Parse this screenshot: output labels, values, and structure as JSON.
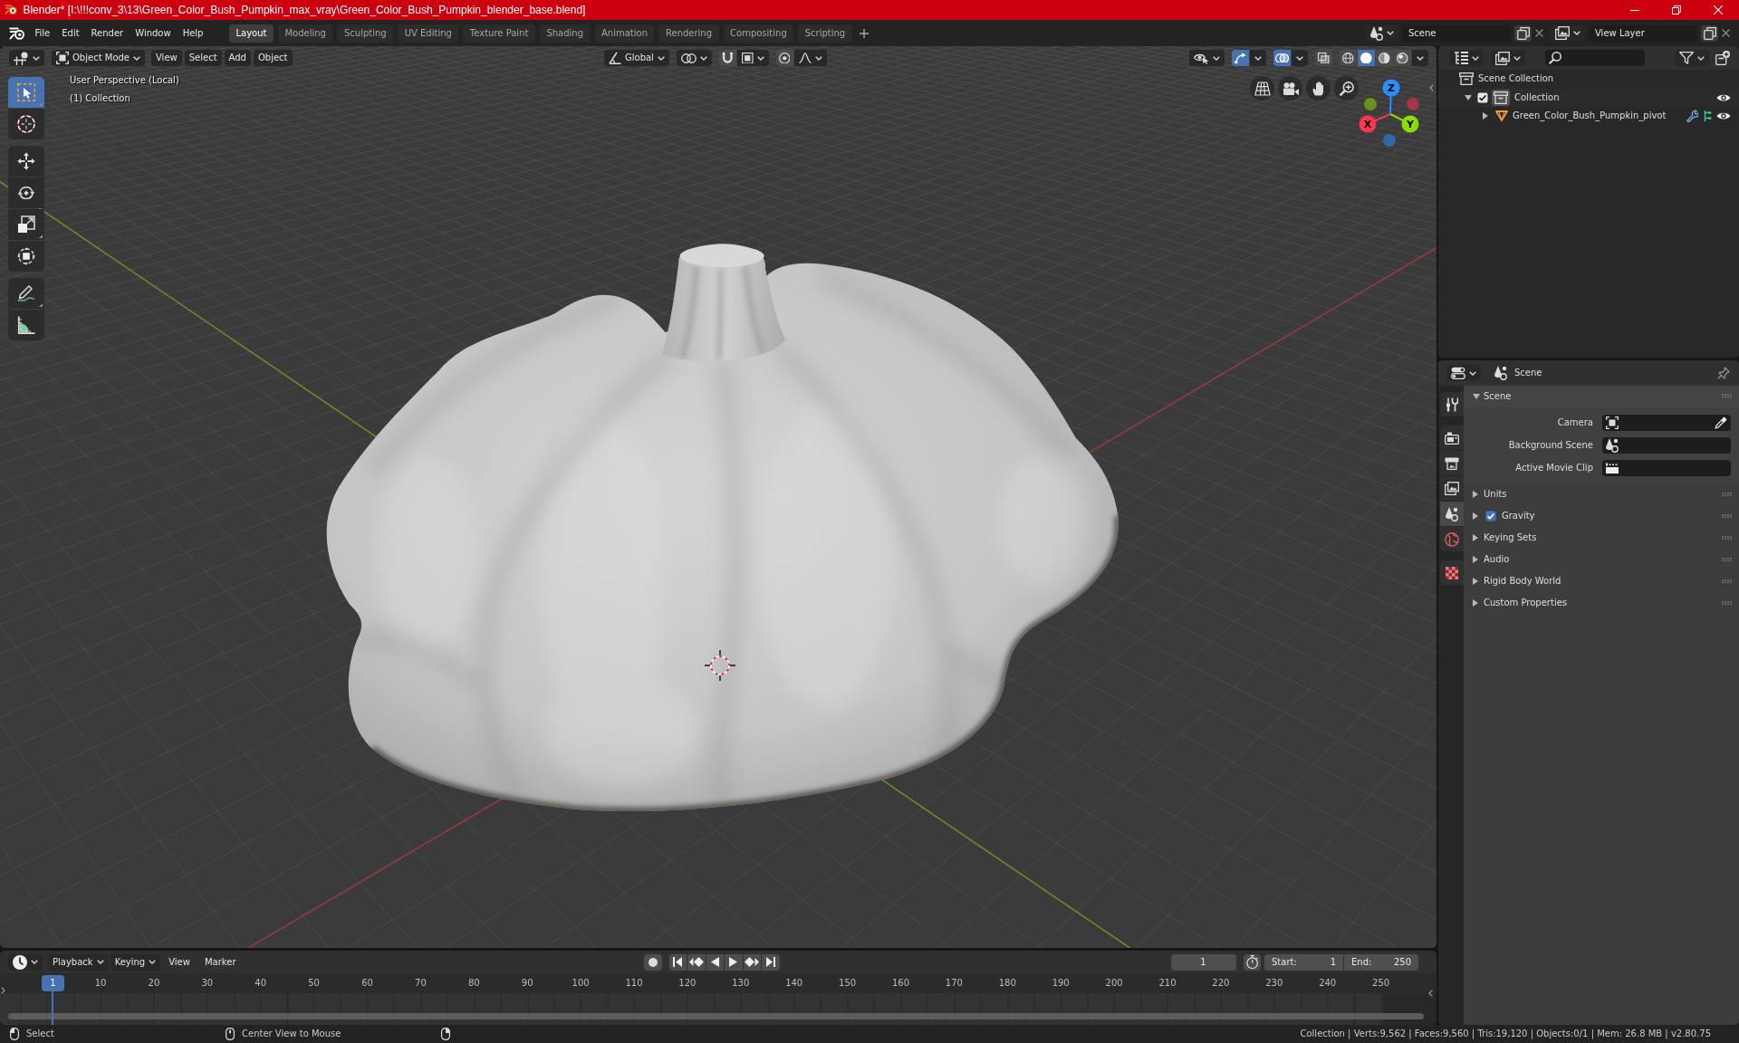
{
  "window": {
    "title": "Blender* [I:\\!!!conv_3\\13\\Green_Color_Bush_Pumpkin_max_vray\\Green_Color_Bush_Pumpkin_blender_base.blend]"
  },
  "menu": [
    "File",
    "Edit",
    "Render",
    "Window",
    "Help"
  ],
  "workspace_tabs": [
    {
      "label": "Layout",
      "selected": true
    },
    {
      "label": "Modeling",
      "selected": false
    },
    {
      "label": "Sculpting",
      "selected": false
    },
    {
      "label": "UV Editing",
      "selected": false
    },
    {
      "label": "Texture Paint",
      "selected": false
    },
    {
      "label": "Shading",
      "selected": false
    },
    {
      "label": "Animation",
      "selected": false
    },
    {
      "label": "Rendering",
      "selected": false
    },
    {
      "label": "Compositing",
      "selected": false
    },
    {
      "label": "Scripting",
      "selected": false
    }
  ],
  "scene_selector": {
    "value": "Scene"
  },
  "view_layer_selector": {
    "value": "View Layer"
  },
  "viewport": {
    "mode": "Object Mode",
    "menus": [
      "View",
      "Select",
      "Add",
      "Object"
    ],
    "orientation": "Global",
    "toggles": [
      {
        "kind": "snap",
        "on": false
      },
      {
        "kind": "proportional",
        "on": false
      },
      {
        "kind": "gizmos",
        "on": true
      },
      {
        "kind": "overlays",
        "on": true
      },
      {
        "kind": "xray",
        "on": false
      }
    ],
    "shading_modes": [
      {
        "kind": "wireframe",
        "selected": false
      },
      {
        "kind": "solid",
        "selected": true
      },
      {
        "kind": "material",
        "selected": false
      },
      {
        "kind": "rendered",
        "selected": false
      }
    ],
    "info": [
      "User Perspective (Local)",
      "(1) Collection"
    ],
    "tool_groups": [
      [
        {
          "kind": "select_box",
          "selected": true
        },
        {
          "kind": "cursor",
          "selected": false
        }
      ],
      [
        {
          "kind": "move",
          "selected": false
        },
        {
          "kind": "rotate",
          "selected": false
        },
        {
          "kind": "scale",
          "selected": false
        },
        {
          "kind": "transform",
          "selected": false
        }
      ],
      [
        {
          "kind": "annotate",
          "selected": false
        },
        {
          "kind": "measure",
          "selected": false
        }
      ]
    ],
    "axes": [
      {
        "label": "X",
        "color": "#ff3352"
      },
      {
        "label": "Y",
        "color": "#8bdc00"
      },
      {
        "label": "Z",
        "color": "#2890ff"
      }
    ]
  },
  "outliner": {
    "tree": [
      {
        "kind": "scene_collection",
        "label": "Scene Collection",
        "children": [
          {
            "kind": "collection",
            "label": "Collection",
            "checked": true,
            "expanded": true,
            "visible": true,
            "children": [
              {
                "kind": "object",
                "label": "Green_Color_Bush_Pumpkin_pivot",
                "expanded": false,
                "visible": true
              }
            ]
          }
        ]
      }
    ]
  },
  "properties": {
    "context": "Scene",
    "tab_groups": [
      [
        {
          "kind": "tool",
          "selected": false
        }
      ],
      [
        {
          "kind": "render",
          "selected": false
        },
        {
          "kind": "output",
          "selected": false
        },
        {
          "kind": "view_layer",
          "selected": false
        },
        {
          "kind": "scene",
          "selected": true
        },
        {
          "kind": "world",
          "selected": false
        }
      ],
      [
        {
          "kind": "texture",
          "selected": false
        }
      ]
    ],
    "panels": [
      {
        "title": "Scene",
        "expanded": true,
        "fields": [
          {
            "kind": "object",
            "label": "Camera"
          },
          {
            "kind": "scene",
            "label": "Background Scene"
          },
          {
            "kind": "clip",
            "label": "Active Movie Clip"
          }
        ]
      },
      {
        "title": "Units",
        "expanded": false
      },
      {
        "title": "Gravity",
        "expanded": false,
        "checked": true
      },
      {
        "title": "Keying Sets",
        "expanded": false
      },
      {
        "title": "Audio",
        "expanded": false
      },
      {
        "title": "Rigid Body World",
        "expanded": false
      },
      {
        "title": "Custom Properties",
        "expanded": false
      }
    ]
  },
  "timeline": {
    "menus": [
      {
        "kind": "dropdown",
        "label": "Playback"
      },
      {
        "kind": "dropdown",
        "label": "Keying"
      },
      {
        "kind": "plain",
        "label": "View"
      },
      {
        "kind": "plain",
        "label": "Marker"
      }
    ],
    "current_frame": "1",
    "start": {
      "label": "Start:",
      "value": "1"
    },
    "end": {
      "label": "End:",
      "value": "250"
    },
    "ruler": {
      "cursor": "1",
      "ticks": [
        "10",
        "20",
        "30",
        "40",
        "50",
        "60",
        "70",
        "80",
        "90",
        "100",
        "110",
        "120",
        "130",
        "140",
        "150",
        "160",
        "170",
        "180",
        "190",
        "200",
        "210",
        "220",
        "230",
        "240",
        "250"
      ]
    }
  },
  "status_bar": {
    "hints": [
      {
        "kind": "left",
        "label": "Select"
      },
      {
        "kind": "middle",
        "label": "Center View to Mouse"
      },
      {
        "kind": "right"
      }
    ],
    "stats": "Collection | Verts:9,562 | Faces:9,560 | Tris:19,120 | Objects:0/1 | Mem: 26.8 MB | v2.80.75"
  }
}
